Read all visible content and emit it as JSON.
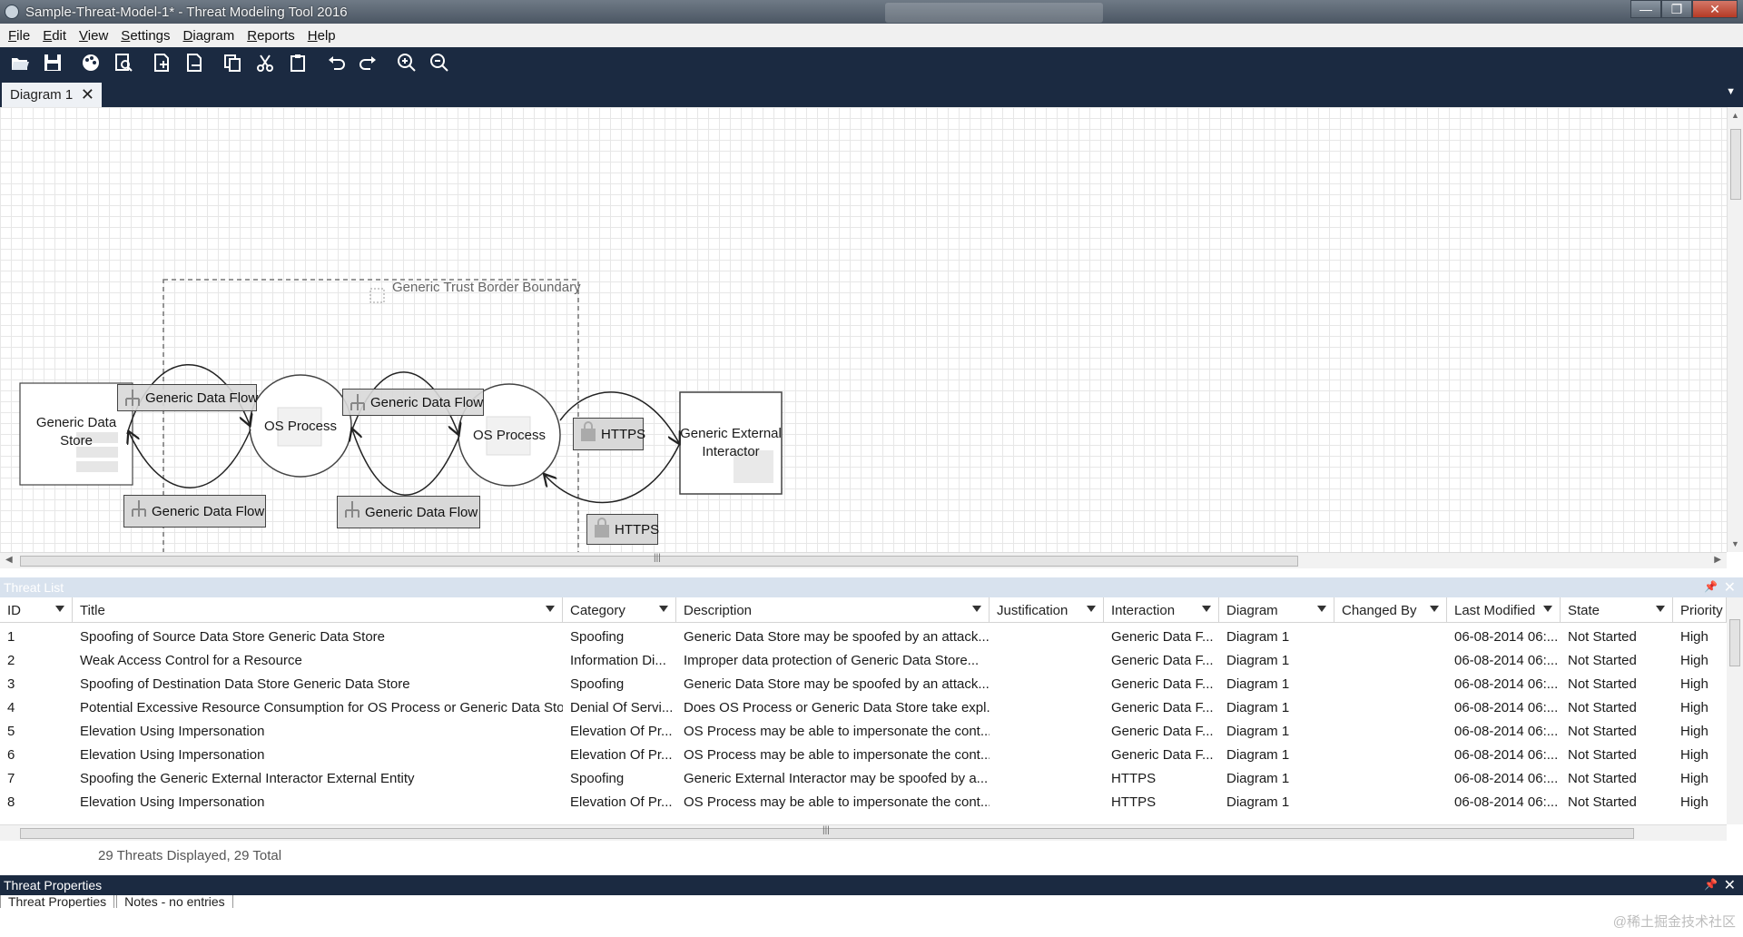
{
  "window": {
    "title": "Sample-Threat-Model-1* - Threat Modeling Tool 2016",
    "controls": {
      "minimize": "—",
      "maximize": "❐",
      "close": "✕"
    }
  },
  "menu": [
    "File",
    "Edit",
    "View",
    "Settings",
    "Diagram",
    "Reports",
    "Help"
  ],
  "toolbar": {
    "icons": [
      "open-icon",
      "save-icon",
      "palette-icon",
      "analysis-view-icon",
      "new-diagram-icon",
      "export-diagram-icon",
      "copy-icon",
      "cut-icon",
      "paste-icon",
      "undo-icon",
      "redo-icon",
      "zoom-in-icon",
      "zoom-out-icon"
    ]
  },
  "tabs": {
    "diagram_tab": "Diagram 1",
    "close_glyph": "✕",
    "dropdown_glyph": "▼"
  },
  "diagram": {
    "trust_boundary": "Generic Trust Border Boundary",
    "data_store": "Generic Data Store",
    "process_1": "OS Process",
    "process_2": "OS Process",
    "external_interactor": "Generic External Interactor",
    "flows": {
      "f1": "Generic Data Flow",
      "f2": "Generic Data Flow",
      "f3": "Generic Data Flow",
      "f4": "Generic Data Flow",
      "https1": "HTTPS",
      "https2": "HTTPS"
    }
  },
  "threat_list": {
    "title": "Threat List",
    "columns": [
      "ID",
      "Title",
      "Category",
      "Description",
      "Justification",
      "Interaction",
      "Diagram",
      "Changed By",
      "Last Modified",
      "State",
      "Priority"
    ],
    "rows": [
      [
        "1",
        "Spoofing of Source Data Store Generic Data Store",
        "Spoofing",
        "Generic Data Store may be spoofed by an attack...",
        "",
        "Generic Data F...",
        "Diagram 1",
        "",
        "06-08-2014 06:...",
        "Not Started",
        "High"
      ],
      [
        "2",
        "Weak Access Control for a Resource",
        "Information Di...",
        "Improper data protection of Generic Data Store...",
        "",
        "Generic Data F...",
        "Diagram 1",
        "",
        "06-08-2014 06:...",
        "Not Started",
        "High"
      ],
      [
        "3",
        "Spoofing of Destination Data Store Generic Data Store",
        "Spoofing",
        "Generic Data Store may be spoofed by an attack...",
        "",
        "Generic Data F...",
        "Diagram 1",
        "",
        "06-08-2014 06:...",
        "Not Started",
        "High"
      ],
      [
        "4",
        "Potential Excessive Resource Consumption for OS Process or Generic Data Store",
        "Denial Of Servi...",
        "Does OS Process or Generic Data Store take expl...",
        "",
        "Generic Data F...",
        "Diagram 1",
        "",
        "06-08-2014 06:...",
        "Not Started",
        "High"
      ],
      [
        "5",
        "Elevation Using Impersonation",
        "Elevation Of Pr...",
        "OS Process may be able to impersonate the cont...",
        "",
        "Generic Data F...",
        "Diagram 1",
        "",
        "06-08-2014 06:...",
        "Not Started",
        "High"
      ],
      [
        "6",
        "Elevation Using Impersonation",
        "Elevation Of Pr...",
        "OS Process may be able to impersonate the cont...",
        "",
        "Generic Data F...",
        "Diagram 1",
        "",
        "06-08-2014 06:...",
        "Not Started",
        "High"
      ],
      [
        "7",
        "Spoofing the Generic External Interactor External Entity",
        "Spoofing",
        "Generic External Interactor may be spoofed by a...",
        "",
        "HTTPS",
        "Diagram 1",
        "",
        "06-08-2014 06:...",
        "Not Started",
        "High"
      ],
      [
        "8",
        "Elevation Using Impersonation",
        "Elevation Of Pr...",
        "OS Process may be able to impersonate the cont...",
        "",
        "HTTPS",
        "Diagram 1",
        "",
        "06-08-2014 06:...",
        "Not Started",
        "High"
      ]
    ],
    "status": "29 Threats Displayed, 29 Total"
  },
  "threat_properties": {
    "title": "Threat Properties",
    "tabs": [
      "Threat Properties",
      "Notes - no entries"
    ]
  },
  "watermark": "@稀土掘金技术社区",
  "colors": {
    "toolbar_bg": "#1b2a41",
    "panel_header_light": "#d8e2ee",
    "grid_line": "#e7e7e7"
  }
}
